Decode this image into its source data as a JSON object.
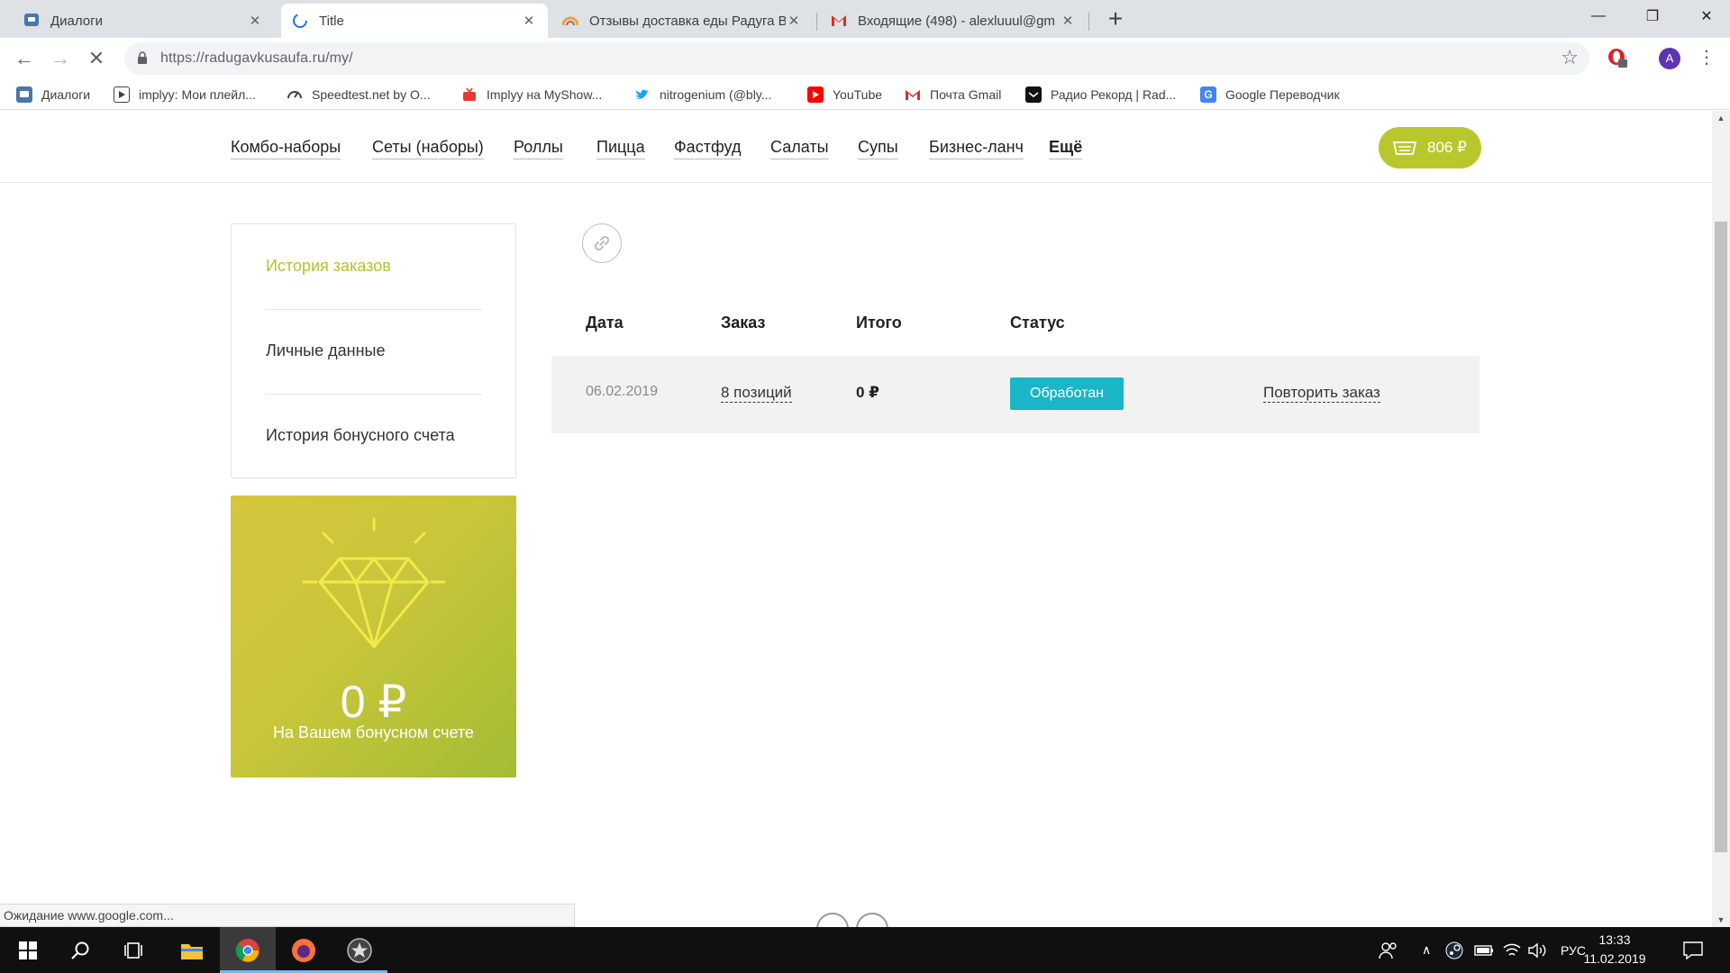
{
  "browser": {
    "tabs": [
      {
        "title": "Диалоги",
        "active": false
      },
      {
        "title": "Title",
        "active": true
      },
      {
        "title": "Отзывы доставка еды Радуга Вк",
        "active": false
      },
      {
        "title": "Входящие (498) - alexluuul@gm",
        "active": false
      }
    ],
    "url_host": "https://radugavkusaufa.ru",
    "url_path": "/my/",
    "bookmarks": [
      {
        "label": "Диалоги",
        "icon": "chat-icon"
      },
      {
        "label": "implyy: Мои плейл...",
        "icon": "play-icon"
      },
      {
        "label": "Speedtest.net by O...",
        "icon": "speedometer-icon"
      },
      {
        "label": "Implyy на MyShow...",
        "icon": "tv-icon"
      },
      {
        "label": "nitrogenium (@bly...",
        "icon": "twitter-icon"
      },
      {
        "label": "YouTube",
        "icon": "youtube-icon"
      },
      {
        "label": "Почта Gmail",
        "icon": "gmail-icon"
      },
      {
        "label": "Радио Рекорд | Rad...",
        "icon": "radio-icon"
      },
      {
        "label": "Google Переводчик",
        "icon": "translate-icon"
      }
    ],
    "avatar_letter": "A",
    "status_text": "Ожидание www.google.com..."
  },
  "site": {
    "nav": [
      "Комбо-наборы",
      "Сеты (наборы)",
      "Роллы",
      "Пицца",
      "Фастфуд",
      "Салаты",
      "Супы",
      "Бизнес-ланч",
      "Ещё"
    ],
    "cart_total": "806 ₽",
    "sidebar": [
      "История заказов",
      "Личные данные",
      "История бонусного счета"
    ],
    "bonus": {
      "amount": "0 ₽",
      "caption": "На Вашем бонусном счете"
    },
    "table": {
      "headers": [
        "Дата",
        "Заказ",
        "Итого",
        "Статус"
      ],
      "rows": [
        {
          "date": "06.02.2019",
          "items": "8 позиций",
          "total": "0 ₽",
          "status": "Обработан",
          "action": "Повторить заказ"
        }
      ]
    }
  },
  "taskbar": {
    "lang": "РУС",
    "time": "13:33",
    "date": "11.02.2019"
  },
  "colors": {
    "accent": "#b9c72d",
    "status_badge": "#1ab5c6",
    "active_sidebar": "#b4c12f"
  }
}
